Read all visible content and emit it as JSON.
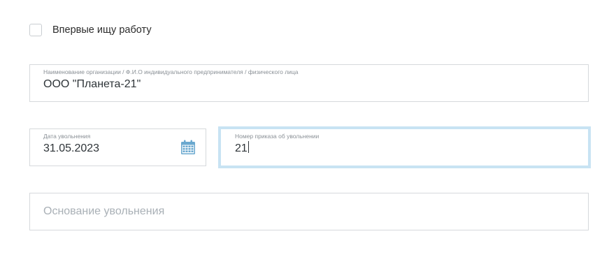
{
  "first_job": {
    "label": "Впервые ищу работу",
    "checked": false
  },
  "organization": {
    "label": "Наименование организации / Ф.И.О индивидуального предпринимателя / физического лица",
    "value": "ООО \"Планета-21\""
  },
  "dismissal_date": {
    "label": "Дата увольнения",
    "value": "31.05.2023",
    "icon": "calendar-icon"
  },
  "order_number": {
    "label": "Номер приказа об увольнении",
    "value": "21",
    "focused": true
  },
  "dismissal_basis": {
    "placeholder": "Основание увольнения",
    "value": ""
  },
  "colors": {
    "focus_border": "#c8e3f3",
    "icon": "#6aa8cf",
    "field_border": "#d6d9dc"
  }
}
